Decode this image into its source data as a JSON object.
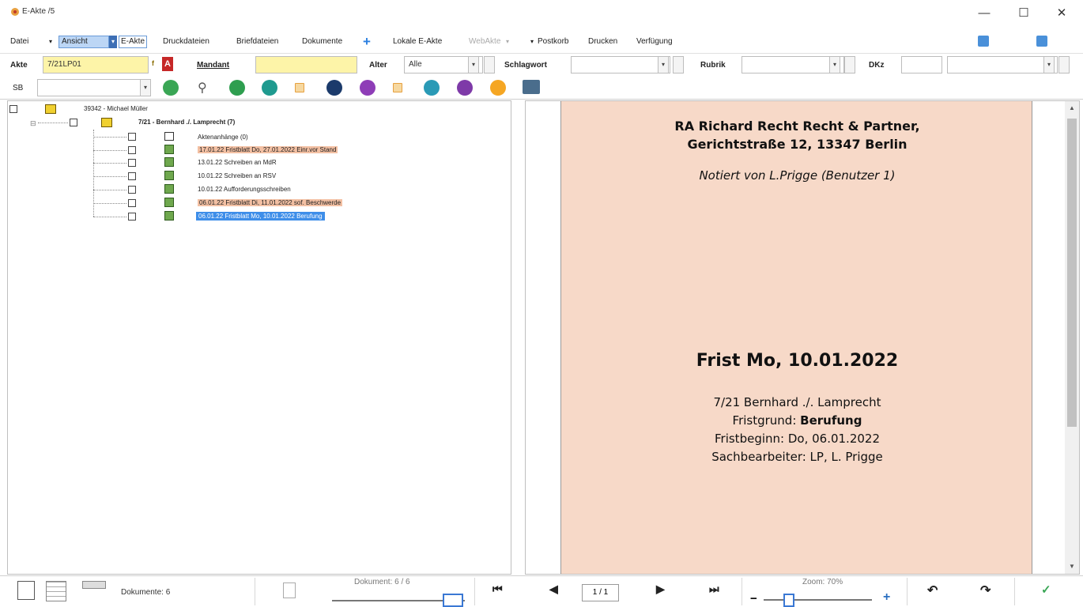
{
  "window": {
    "title": "E-Akte /5",
    "minimize": "—",
    "maximize": "☐",
    "close": "✕"
  },
  "menu": {
    "datei": "Datei",
    "ansicht": "Ansicht",
    "eakte": "E-Akte",
    "druckdateien": "Druckdateien",
    "briefdateien": "Briefdateien",
    "dokumente": "Dokumente",
    "lokale": "Lokale E-Akte",
    "webakte": "WebAkte",
    "postkorb": "Postkorb",
    "drucken": "Drucken",
    "verfuegung": "Verfügung"
  },
  "filters": {
    "akte_label": "Akte",
    "akte_value": "7/21LP01",
    "mandant_label": "Mandant",
    "mandant_value": "",
    "alter_label": "Alter",
    "alter_value": "Alle",
    "schlagwort_label": "Schlagwort",
    "schlagwort_value": "",
    "rubrik_label": "Rubrik",
    "rubrik_value": "",
    "dkz_label": "DKz",
    "dkz_value": "",
    "sb_label": "SB",
    "sb_value": ""
  },
  "tree": {
    "root": "39342 - Michael Müller",
    "akte": "7/21 - Bernhard ./. Lamprecht (7)",
    "items": [
      "Aktenanhänge (0)",
      "17.01.22 Fristblatt Do, 27.01.2022 Einr.vor Stand",
      "13.01.22 Schreiben an MdR",
      "10.01.22 Schreiben an RSV",
      "10.01.22 Aufforderungsschreiben",
      "06.01.22 Fristblatt Di, 11.01.2022 sof. Beschwerde",
      "06.01.22 Fristblatt Mo, 10.01.2022 Berufung"
    ]
  },
  "document": {
    "line1": "RA Richard Recht Recht & Partner,",
    "line2": "Gerichtstraße 12, 13347 Berlin",
    "notiert": "Notiert von L.Prigge (Benutzer 1)",
    "frist": "Frist Mo, 10.01.2022",
    "akte": "7/21  Bernhard ./. Lamprecht",
    "fristgrund_label": "Fristgrund: ",
    "fristgrund_value": "Berufung",
    "fristbeginn": "Fristbeginn: Do, 06.01.2022",
    "sachbearbeiter": "Sachbearbeiter: LP, L. Prigge"
  },
  "status": {
    "dokumente": "Dokumente: 6",
    "dokument_pos": "Dokument: 6 / 6",
    "page": "1 / 1",
    "zoom": "Zoom: 70%",
    "zoom_value": 0.18
  },
  "colors": {
    "highlight": "#f3c0a3",
    "selection": "#3e8ee9",
    "page_bg": "#f7d9c8"
  }
}
